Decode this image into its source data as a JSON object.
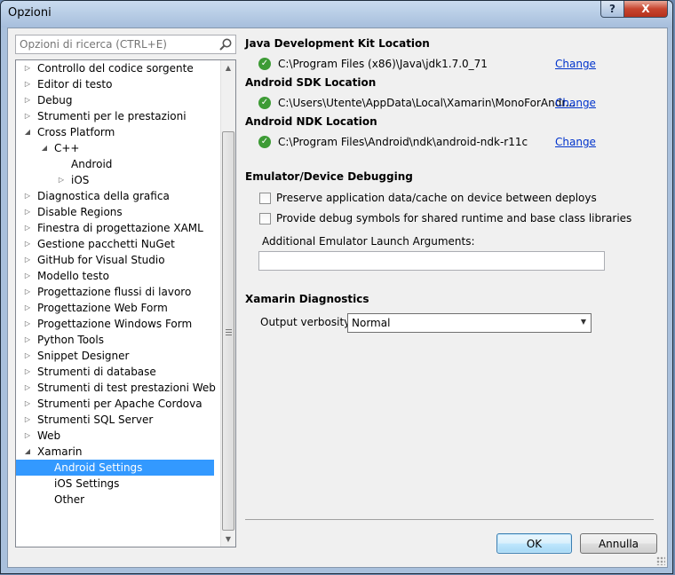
{
  "window": {
    "title": "Opzioni"
  },
  "search": {
    "placeholder": "Opzioni di ricerca (CTRL+E)"
  },
  "tree": [
    {
      "label": "Controllo del codice sorgente",
      "level": 0,
      "arrow": "right"
    },
    {
      "label": "Editor di testo",
      "level": 0,
      "arrow": "right"
    },
    {
      "label": "Debug",
      "level": 0,
      "arrow": "right"
    },
    {
      "label": "Strumenti per le prestazioni",
      "level": 0,
      "arrow": "right"
    },
    {
      "label": "Cross Platform",
      "level": 0,
      "arrow": "down"
    },
    {
      "label": "C++",
      "level": 1,
      "arrow": "down"
    },
    {
      "label": "Android",
      "level": 2,
      "arrow": ""
    },
    {
      "label": "iOS",
      "level": 2,
      "arrow": "right"
    },
    {
      "label": "Diagnostica della grafica",
      "level": 0,
      "arrow": "right"
    },
    {
      "label": "Disable Regions",
      "level": 0,
      "arrow": "right"
    },
    {
      "label": "Finestra di progettazione XAML",
      "level": 0,
      "arrow": "right"
    },
    {
      "label": "Gestione pacchetti NuGet",
      "level": 0,
      "arrow": "right"
    },
    {
      "label": "GitHub for Visual Studio",
      "level": 0,
      "arrow": "right"
    },
    {
      "label": "Modello testo",
      "level": 0,
      "arrow": "right"
    },
    {
      "label": "Progettazione flussi di lavoro",
      "level": 0,
      "arrow": "right"
    },
    {
      "label": "Progettazione Web Form",
      "level": 0,
      "arrow": "right"
    },
    {
      "label": "Progettazione Windows Form",
      "level": 0,
      "arrow": "right"
    },
    {
      "label": "Python Tools",
      "level": 0,
      "arrow": "right"
    },
    {
      "label": "Snippet Designer",
      "level": 0,
      "arrow": "right"
    },
    {
      "label": "Strumenti di database",
      "level": 0,
      "arrow": "right"
    },
    {
      "label": "Strumenti di test prestazioni Web",
      "level": 0,
      "arrow": "right"
    },
    {
      "label": "Strumenti per Apache Cordova",
      "level": 0,
      "arrow": "right"
    },
    {
      "label": "Strumenti SQL Server",
      "level": 0,
      "arrow": "right"
    },
    {
      "label": "Web",
      "level": 0,
      "arrow": "right"
    },
    {
      "label": "Xamarin",
      "level": 0,
      "arrow": "down"
    },
    {
      "label": "Android Settings",
      "level": 1,
      "arrow": "",
      "selected": true
    },
    {
      "label": "iOS Settings",
      "level": 1,
      "arrow": ""
    },
    {
      "label": "Other",
      "level": 1,
      "arrow": ""
    }
  ],
  "sdk": {
    "java_title": "Java Development Kit Location",
    "java_path": "C:\\Program Files (x86)\\Java\\jdk1.7.0_71",
    "android_sdk_title": "Android SDK Location",
    "android_sdk_path": "C:\\Users\\Utente\\AppData\\Local\\Xamarin\\MonoForAndr...",
    "android_ndk_title": "Android NDK Location",
    "android_ndk_path": "C:\\Program Files\\Android\\ndk\\android-ndk-r11c",
    "change_label": "Change"
  },
  "emulator": {
    "title": "Emulator/Device Debugging",
    "preserve_label": "Preserve application data/cache on device between deploys",
    "preserve_checked": false,
    "debug_symbols_label": "Provide debug symbols for shared runtime and base class libraries",
    "debug_symbols_checked": false,
    "args_label": "Additional Emulator Launch Arguments:",
    "args_value": ""
  },
  "diagnostics": {
    "title": "Xamarin Diagnostics",
    "verbosity_label": "Output verbosity:",
    "verbosity_value": "Normal"
  },
  "buttons": {
    "ok": "OK",
    "cancel": "Annulla",
    "help": "?",
    "close": "X"
  },
  "colors": {
    "selection": "#3399ff",
    "link": "#0033cc",
    "success": "#3d9b35"
  }
}
